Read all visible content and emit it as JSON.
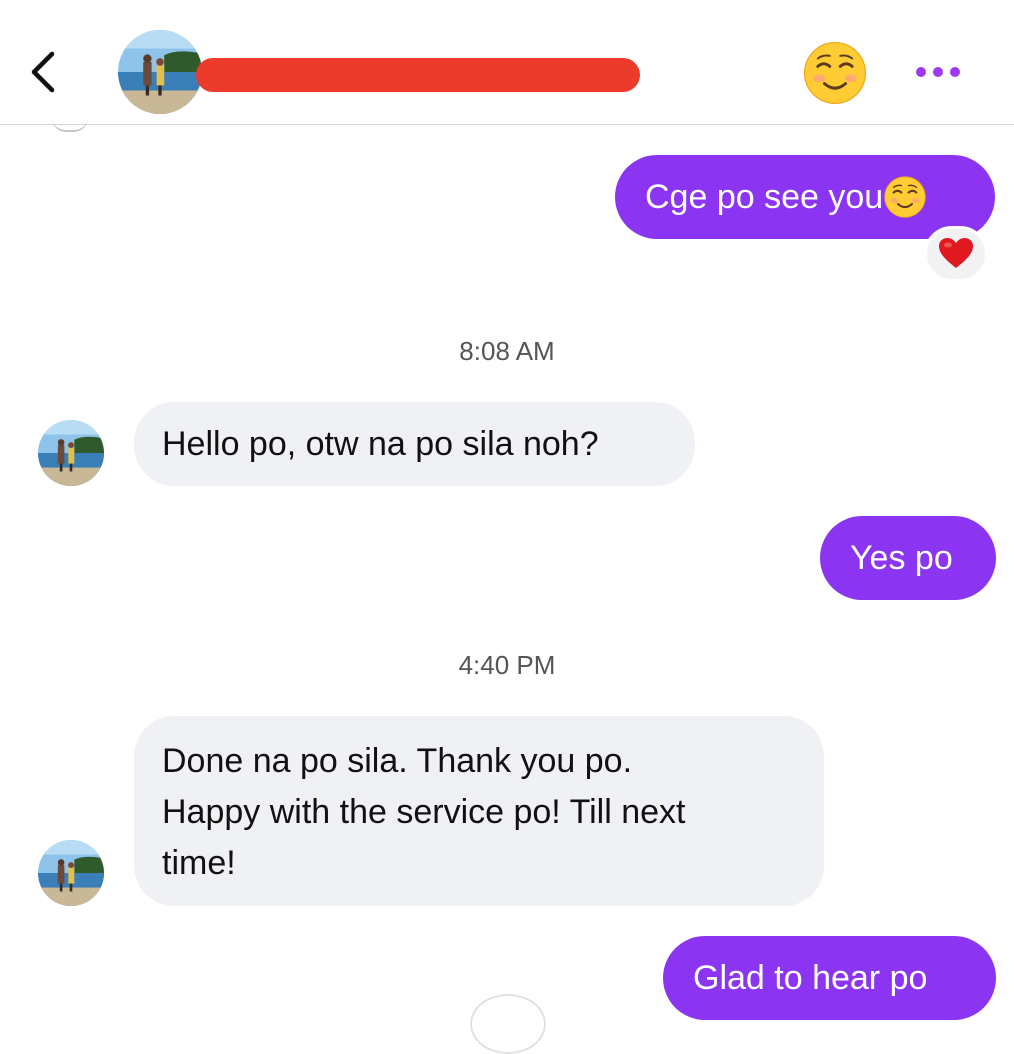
{
  "header": {
    "contact_name_redacted": true,
    "icons": {
      "back": "chevron-left-icon",
      "emoji": "smiling-face-emoji-icon",
      "more": "more-dots-icon"
    },
    "accent_color": "#9b3af5"
  },
  "messages": [
    {
      "id": "m1",
      "direction": "outgoing",
      "text": "Cge po see you",
      "emoji": "smiling-face-emoji",
      "reaction": "red-heart"
    },
    {
      "id": "t1",
      "type": "timestamp",
      "text": "8:08 AM"
    },
    {
      "id": "m2",
      "direction": "incoming",
      "text": "Hello po, otw na po sila noh?"
    },
    {
      "id": "m3",
      "direction": "outgoing",
      "text": "Yes po"
    },
    {
      "id": "t2",
      "type": "timestamp",
      "text": "4:40 PM"
    },
    {
      "id": "m4",
      "direction": "incoming",
      "lines": [
        "Done na po sila. Thank you po.",
        "Happy with the service po! Till next",
        "time!"
      ]
    },
    {
      "id": "m5",
      "direction": "outgoing",
      "text": "Glad to hear po"
    }
  ],
  "colors": {
    "outgoing_bubble": "#8b35f2",
    "incoming_bubble": "#f0f1f5",
    "redaction": "#ec3b2b"
  }
}
